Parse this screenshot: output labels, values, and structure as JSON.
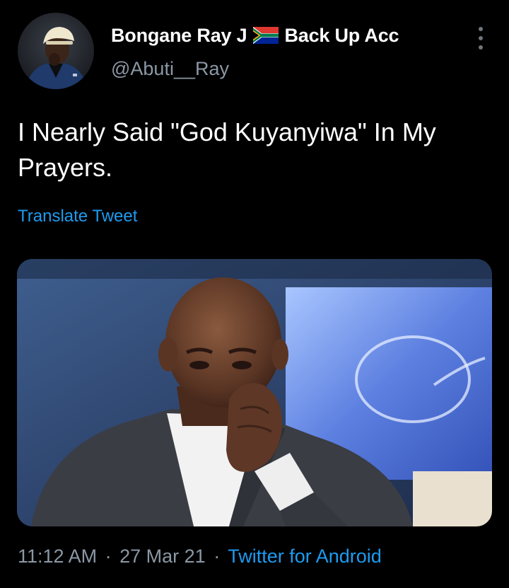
{
  "tweet": {
    "author": {
      "display_name_part1": "Bongane Ray J",
      "flag_icon": "south-africa-flag-icon",
      "display_name_part2": "Back Up Acc",
      "handle": "@Abuti__Ray"
    },
    "text": "I Nearly Said \"God Kuyanyiwa\" In My Prayers.",
    "translate_label": "Translate Tweet",
    "meta": {
      "time": "11:12 AM",
      "separator": "·",
      "date": "27 Mar 21",
      "source": "Twitter for Android"
    },
    "more_icon": "vertical-ellipsis-icon"
  },
  "colors": {
    "background": "#000000",
    "primary_text": "#ffffff",
    "secondary_text": "#8b98a5",
    "link": "#1d9bf0"
  }
}
